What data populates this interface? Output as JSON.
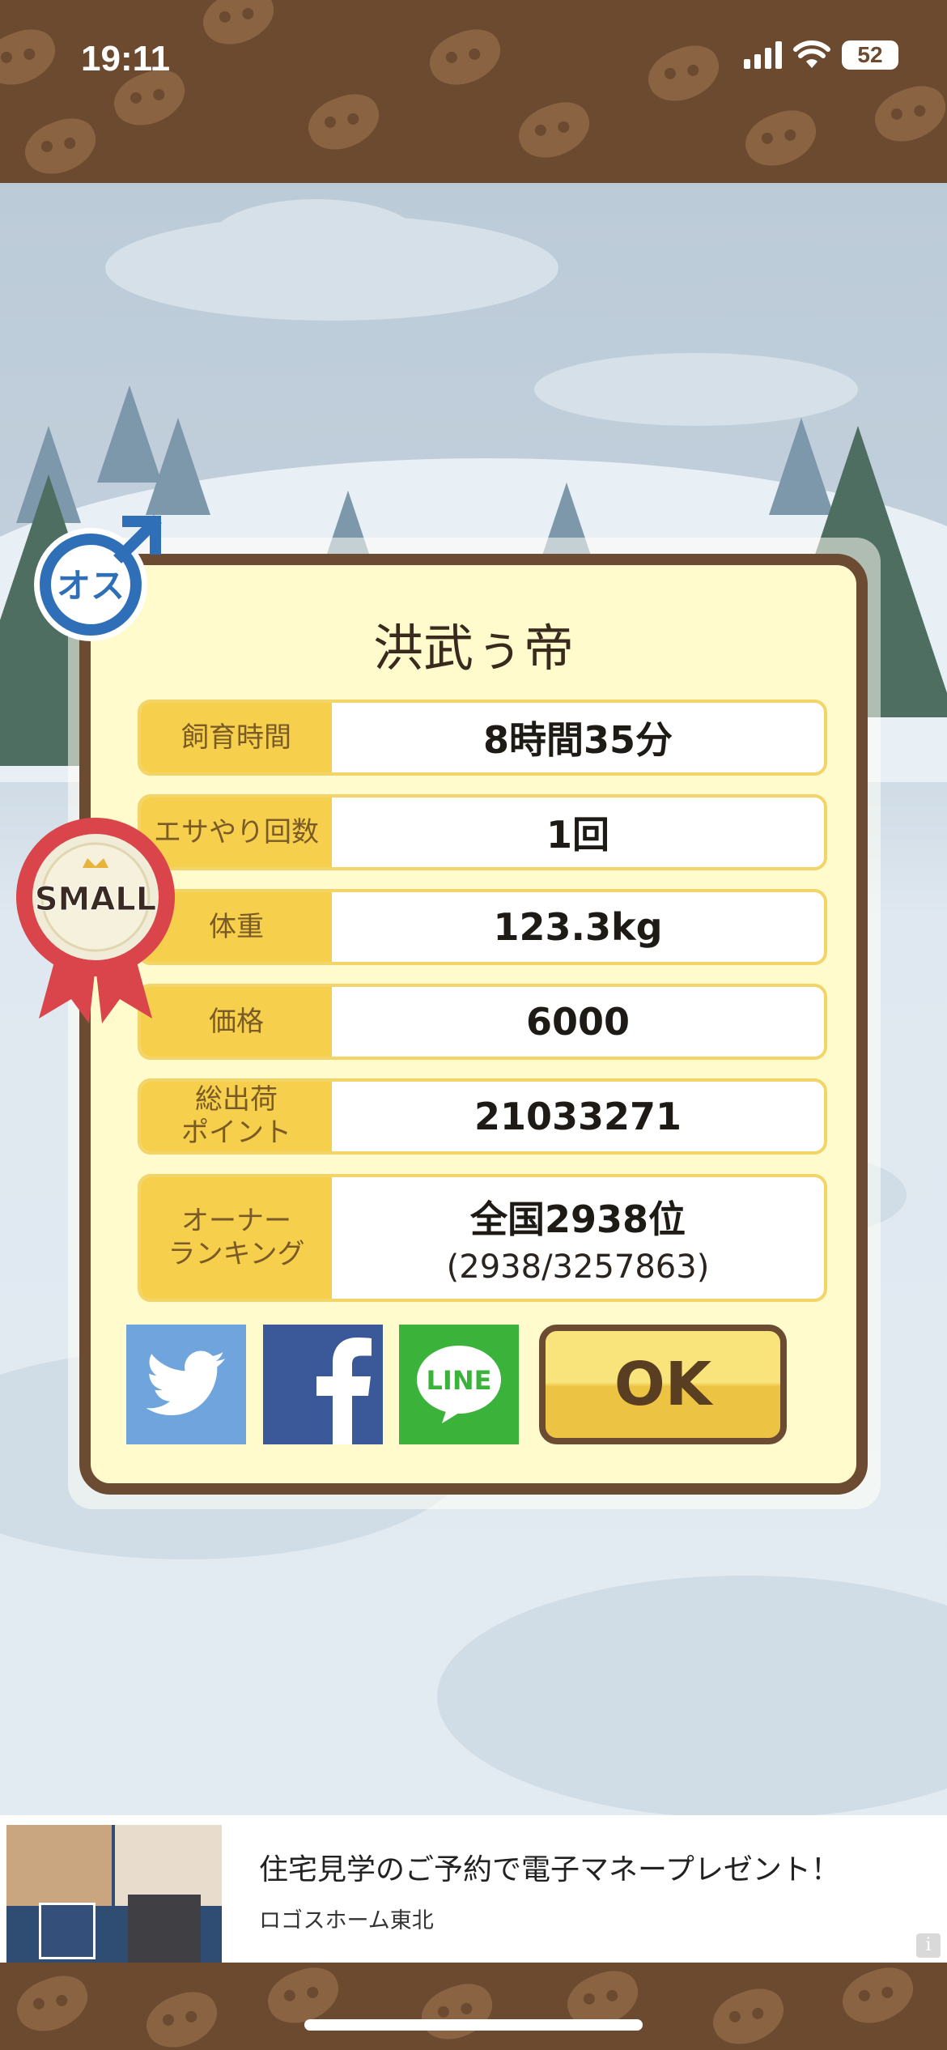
{
  "status_bar": {
    "time": "19:11",
    "battery": "52",
    "icons": [
      "cellular-signal-icon",
      "wifi-icon",
      "battery-icon"
    ]
  },
  "badges": {
    "gender": "オス",
    "size": "SMALL"
  },
  "modal": {
    "title": "洪武ぅ帝",
    "rows": [
      {
        "label": "飼育時間",
        "value": "8時間35分"
      },
      {
        "label": "エサやり回数",
        "value": "1回"
      },
      {
        "label": "体重",
        "value": "123.3kg"
      },
      {
        "label": "価格",
        "value": "6000"
      },
      {
        "label": "総出荷\nポイント",
        "value": "21033271"
      },
      {
        "label": "オーナー\nランキング",
        "value": "全国2938位",
        "sub": "(2938/3257863)"
      }
    ],
    "share_buttons": [
      "twitter",
      "facebook",
      "LINE"
    ],
    "ok_label": "OK"
  },
  "ad": {
    "title": "住宅見学のご予約で電子マネープレゼント！",
    "advertiser": "ロゴスホーム東北",
    "info": "i"
  },
  "colors": {
    "brown": "#6b4a2f",
    "panel": "#fffbcc",
    "label_yellow": "#f6d04d",
    "twitter": "#6fa4dc",
    "facebook": "#3b5998",
    "line": "#3bb33b"
  }
}
